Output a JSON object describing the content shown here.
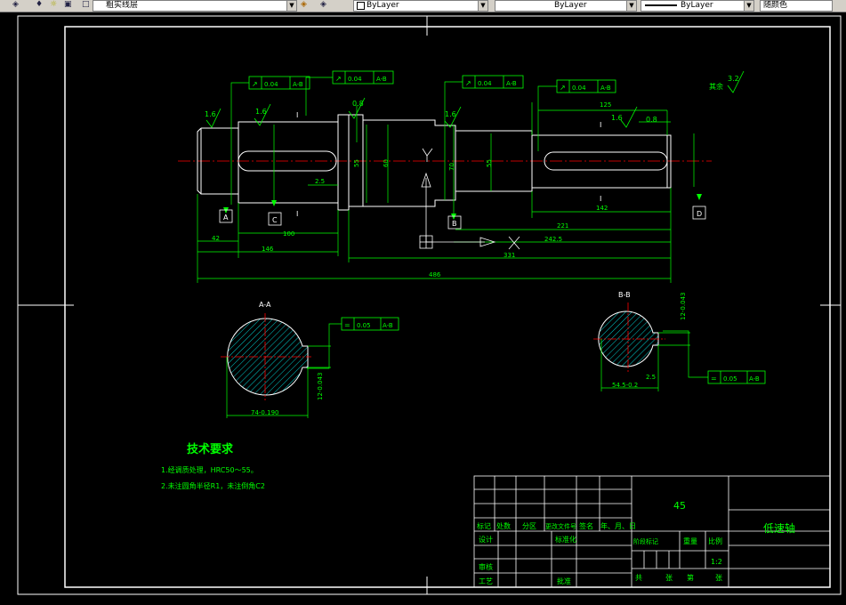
{
  "toolbar": {
    "layer_name": "粗实线层",
    "color_value": "ByLayer",
    "linetype_value": "ByLayer",
    "lineweight_value": "ByLayer",
    "plotstyle_value": "随颜色",
    "icons": [
      "layer-manager-icon",
      "layer-state-icon",
      "lightbulb-icon",
      "sun-icon",
      "lock-icon",
      "color-square-icon",
      "make-current-icon",
      "layer-previous-icon"
    ]
  },
  "drawing": {
    "colors": {
      "background": "#000000",
      "frame": "#ffffff",
      "geometry": "#ffffff",
      "dimension": "#00ff00",
      "centerline": "#ff0000",
      "hatch": "#00ffff",
      "text_green": "#00ff00",
      "title_text": "#00ff00"
    },
    "roughness": {
      "general": "3.2",
      "general_prefix": "其余",
      "r1": "1.6",
      "r2": "1.6",
      "r3": "0.8",
      "r4": "1.6",
      "r5": "1.6",
      "r6": "0.8"
    },
    "tolerances": {
      "t1": {
        "sym": "↗",
        "val": "0.04",
        "datum": "A-B"
      },
      "t2": {
        "sym": "↗",
        "val": "0.04",
        "datum": "A-B"
      },
      "t3": {
        "sym": "↗",
        "val": "0.04",
        "datum": "A-B"
      },
      "t4": {
        "sym": "↗",
        "val": "0.04",
        "datum": "A-B"
      },
      "t5": {
        "sym": "=",
        "val": "0.05",
        "datum": "A-B"
      },
      "t6": {
        "sym": "=",
        "val": "0.05",
        "datum": "A-B"
      }
    },
    "dims": {
      "d125": "125",
      "d2_5a": "2.5",
      "d2_5b": "2.5",
      "d42": "42",
      "d100": "100",
      "d146": "146",
      "d221": "221",
      "d142": "142",
      "d242_5": "242.5",
      "d331": "331",
      "d486": "486",
      "d74": "74-0.190",
      "d54": "54.5-0.2",
      "d12a": "12-0.043",
      "d12b": "12-0.043",
      "d55": "55",
      "d55b": "55",
      "d60": "60",
      "d70": "70"
    },
    "datums": {
      "a": "A",
      "c": "C",
      "b": "B",
      "d": "D",
      "i1": "I",
      "i2": "I",
      "i3": "I",
      "i4": "I"
    },
    "section_labels": {
      "aa": "A-A",
      "bb": "B-B"
    },
    "tech": {
      "heading": "技术要求",
      "line1": "1.经调质处理，HRC50～55。",
      "line2": "2.未注圆角半径R1，未注倒角C2"
    },
    "titleblock": {
      "material": "45",
      "part_name": "低速轴",
      "scale_value": "1:2",
      "labels": {
        "mark": "标记",
        "count": "处数",
        "zone": "分区",
        "change_doc": "更改文件号",
        "sign": "签名",
        "date": "年、月、日",
        "design": "设计",
        "standardize": "标准化",
        "stage_mark": "阶段标记",
        "weight": "重量",
        "scale": "比例",
        "review": "审核",
        "process": "工艺",
        "approve": "批准",
        "total": "共",
        "sheet1": "张",
        "page": "第",
        "sheet2": "张"
      }
    }
  }
}
